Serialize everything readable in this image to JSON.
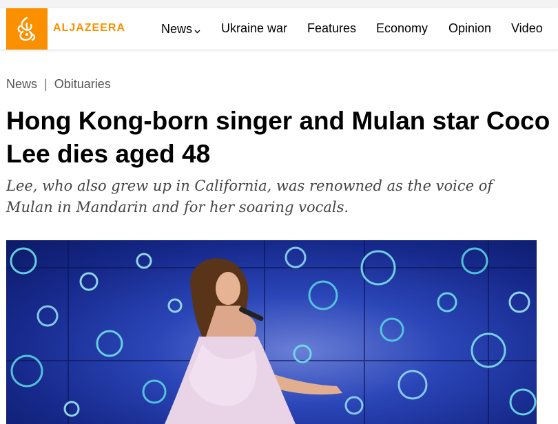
{
  "brand": {
    "name": "ALJAZEERA",
    "accent": "#fa9000"
  },
  "nav": {
    "items": [
      {
        "label": "News",
        "has_dropdown": true
      },
      {
        "label": "Ukraine war"
      },
      {
        "label": "Features"
      },
      {
        "label": "Economy"
      },
      {
        "label": "Opinion"
      },
      {
        "label": "Video"
      }
    ]
  },
  "breadcrumb": {
    "section": "News",
    "separator": "|",
    "subsection": "Obituaries"
  },
  "article": {
    "title": "Hong Kong-born singer and Mulan star Coco Lee dies aged 48",
    "subtitle": "Lee, who also grew up in California, was renowned as the voice of Mulan in Mandarin and for her soaring vocals.",
    "image_icon": "photo-of-singer-performing-on-stage"
  }
}
